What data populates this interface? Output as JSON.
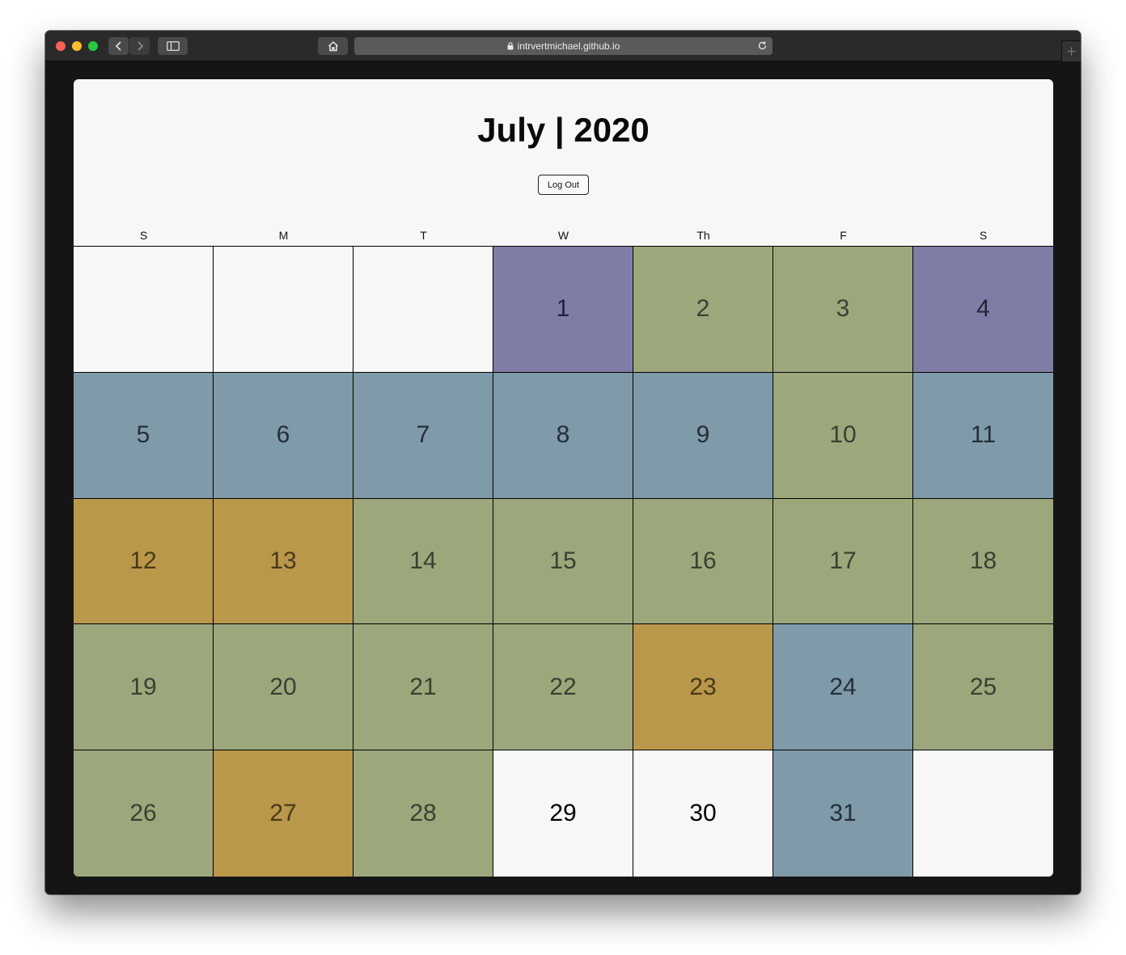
{
  "browser": {
    "url": "intrvertmichael.github.io"
  },
  "header": {
    "title": "July | 2020",
    "logout_label": "Log Out"
  },
  "weekdays": [
    "S",
    "M",
    "T",
    "W",
    "Th",
    "F",
    "S"
  ],
  "colors": {
    "purple": "#7f7ca6",
    "olive": "#9ca77c",
    "steel": "#7f9aa8",
    "gold": "#b9974b",
    "empty": "#f7f7f7"
  },
  "days": [
    {
      "label": "",
      "color": "empty"
    },
    {
      "label": "",
      "color": "empty"
    },
    {
      "label": "",
      "color": "empty"
    },
    {
      "label": "1",
      "color": "purple"
    },
    {
      "label": "2",
      "color": "olive"
    },
    {
      "label": "3",
      "color": "olive"
    },
    {
      "label": "4",
      "color": "purple"
    },
    {
      "label": "5",
      "color": "steel"
    },
    {
      "label": "6",
      "color": "steel"
    },
    {
      "label": "7",
      "color": "steel"
    },
    {
      "label": "8",
      "color": "steel"
    },
    {
      "label": "9",
      "color": "steel"
    },
    {
      "label": "10",
      "color": "olive"
    },
    {
      "label": "11",
      "color": "steel"
    },
    {
      "label": "12",
      "color": "gold"
    },
    {
      "label": "13",
      "color": "gold"
    },
    {
      "label": "14",
      "color": "olive"
    },
    {
      "label": "15",
      "color": "olive"
    },
    {
      "label": "16",
      "color": "olive"
    },
    {
      "label": "17",
      "color": "olive"
    },
    {
      "label": "18",
      "color": "olive"
    },
    {
      "label": "19",
      "color": "olive"
    },
    {
      "label": "20",
      "color": "olive"
    },
    {
      "label": "21",
      "color": "olive"
    },
    {
      "label": "22",
      "color": "olive"
    },
    {
      "label": "23",
      "color": "gold"
    },
    {
      "label": "24",
      "color": "steel"
    },
    {
      "label": "25",
      "color": "olive"
    },
    {
      "label": "26",
      "color": "olive"
    },
    {
      "label": "27",
      "color": "gold"
    },
    {
      "label": "28",
      "color": "olive"
    },
    {
      "label": "29",
      "color": "empty"
    },
    {
      "label": "30",
      "color": "empty"
    },
    {
      "label": "31",
      "color": "steel"
    },
    {
      "label": "",
      "color": "empty"
    }
  ]
}
